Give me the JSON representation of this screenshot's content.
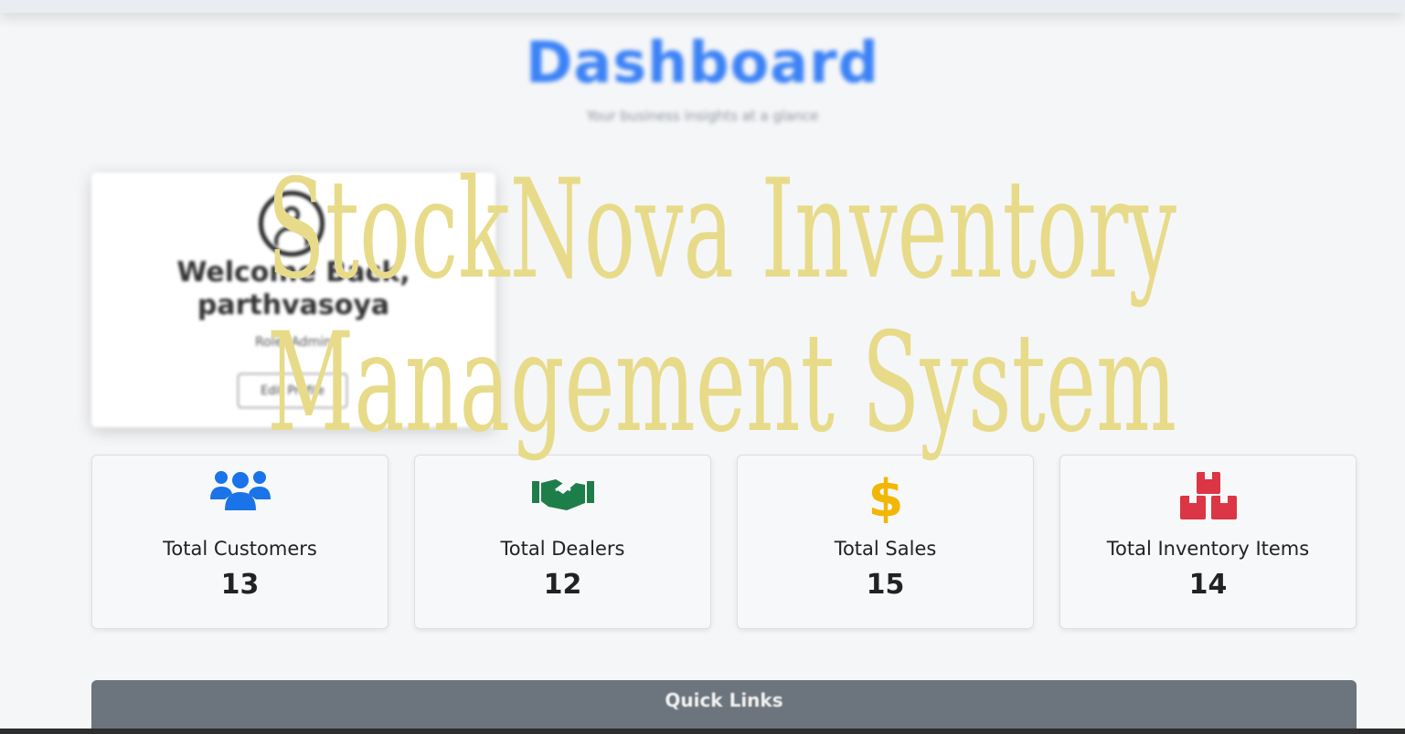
{
  "header": {
    "title": "Dashboard",
    "subtitle": "Your business insights at a glance"
  },
  "profile": {
    "welcome": "Welcome Back,",
    "username": "parthvasoya",
    "role": "Role: Admin",
    "edit_label": "Edit Profile"
  },
  "stats": [
    {
      "label": "Total Customers",
      "value": "13",
      "icon": "users-icon",
      "color": "#1a73e8"
    },
    {
      "label": "Total Dealers",
      "value": "12",
      "icon": "handshake-icon",
      "color": "#1e7e4a"
    },
    {
      "label": "Total Sales",
      "value": "15",
      "icon": "dollar-icon",
      "color": "#f2b705"
    },
    {
      "label": "Total Inventory Items",
      "value": "14",
      "icon": "boxes-icon",
      "color": "#dc3545"
    }
  ],
  "quick_links": {
    "title": "Quick Links"
  },
  "watermark": {
    "line1": "StockNova Inventory",
    "line2": "Management System"
  }
}
